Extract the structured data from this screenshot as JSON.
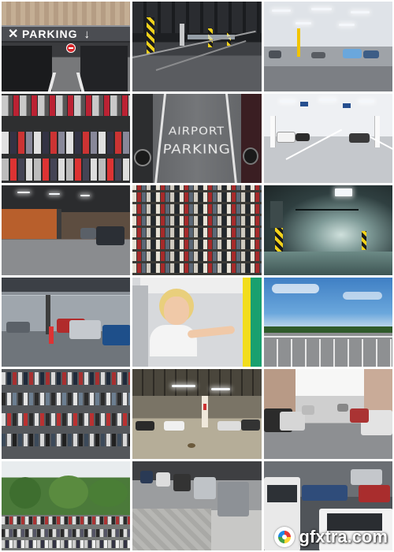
{
  "collage": {
    "tile1": {
      "sign_text": "PARKING",
      "sign_arrow": "↓",
      "sign_x": "✕"
    },
    "tile5": {
      "line1": "AIRPORT",
      "line2": "PARKING"
    }
  },
  "watermark": {
    "text": "gfxtra.com",
    "icon": "gfxtra-logo-icon"
  },
  "colors": {
    "background": "#ffffff",
    "sign_gray": "#4b4d52",
    "sky_blue": "#6aa7dc"
  }
}
